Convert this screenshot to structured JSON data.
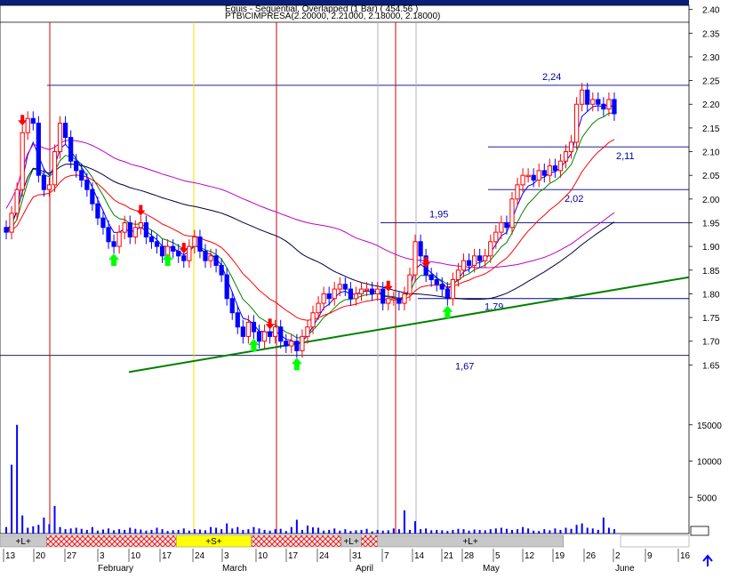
{
  "header": {
    "line1": "Equis - Sequential, Overlapped (1 Bar) ( 454.56 )",
    "line2": "PTB\\CIMPRESA(2.20000, 2.21000, 2.18000, 2.18000)"
  },
  "colors": {
    "up_candle": "#ff0000",
    "down_candle": "#0000ff",
    "volume": "#0000ff",
    "ema_fast": "#0000ff",
    "ema_mid": "#008000",
    "ema_slow": "#ff0000",
    "ma_magenta": "#c000c0",
    "ma_navy": "#000040",
    "trendline": "#008000",
    "buy_arrow": "#00ff00",
    "sell_arrow": "#ff0000"
  },
  "chart_data": {
    "type": "candlestick",
    "title": "PTB\\CIMPRESA(2.20000, 2.21000, 2.18000, 2.18000)",
    "ylim": [
      1.6,
      2.42
    ],
    "y_ticks": [
      1.65,
      1.7,
      1.75,
      1.8,
      1.85,
      1.9,
      1.95,
      2.0,
      2.05,
      2.1,
      2.15,
      2.2,
      2.25,
      2.3,
      2.35,
      2.4
    ],
    "y_tick_labels": [
      "1.65",
      "1.70",
      "1.75",
      "1.80",
      "1.85",
      "1.90",
      "1.95",
      "2.00",
      "2.05",
      "2.10",
      "2.15",
      "2.20",
      "2.25",
      "2.30",
      "2.35",
      "2.40"
    ],
    "volume_ticks": [
      5000,
      10000,
      15000
    ],
    "volume_tick_labels": [
      "5000",
      "10000",
      "15000"
    ],
    "volume_ylim": [
      0,
      20000
    ],
    "x_day_labels": [
      "13",
      "20",
      "27",
      "3",
      "10",
      "17",
      "24",
      "3",
      "10",
      "17",
      "24",
      "31",
      "7",
      "14",
      "21",
      "28",
      "5",
      "12",
      "19",
      "26",
      "2",
      "9",
      "16"
    ],
    "x_month_labels": [
      "February",
      "March",
      "April",
      "May",
      "June"
    ],
    "horizontal_levels": [
      {
        "value": 2.24,
        "label": "2,24"
      },
      {
        "value": 2.11,
        "label": "2,11"
      },
      {
        "value": 2.02,
        "label": "2,02"
      },
      {
        "value": 1.95,
        "label": "1,95"
      },
      {
        "value": 1.79,
        "label": "1,79"
      },
      {
        "value": 1.67,
        "label": "1,67"
      }
    ],
    "trendline": {
      "start": [
        0.18,
        1.635
      ],
      "end": [
        1.0,
        1.835
      ]
    },
    "signal_bands": [
      {
        "label": "+L+",
        "start": 0.0,
        "end": 0.075,
        "style": "gray"
      },
      {
        "label": "",
        "start": 0.075,
        "end": 0.284,
        "style": "hatch"
      },
      {
        "label": "+S+",
        "start": 0.284,
        "end": 0.405,
        "style": "yellow"
      },
      {
        "label": "",
        "start": 0.405,
        "end": 0.55,
        "style": "hatch"
      },
      {
        "label": "+L+",
        "start": 0.55,
        "end": 0.582,
        "style": "gray"
      },
      {
        "label": "",
        "start": 0.582,
        "end": 0.608,
        "style": "hatch"
      },
      {
        "label": "+L+",
        "start": 0.608,
        "end": 0.908,
        "style": "gray"
      }
    ],
    "candles_close": [
      1.93,
      1.97,
      2.02,
      2.14,
      2.17,
      2.16,
      2.05,
      2.02,
      2.03,
      2.1,
      2.16,
      2.13,
      2.08,
      2.06,
      2.04,
      2.02,
      1.99,
      1.96,
      1.94,
      1.91,
      1.9,
      1.93,
      1.95,
      1.92,
      1.94,
      1.95,
      1.92,
      1.91,
      1.9,
      1.88,
      1.9,
      1.89,
      1.88,
      1.87,
      1.9,
      1.92,
      1.89,
      1.87,
      1.88,
      1.86,
      1.84,
      1.79,
      1.76,
      1.73,
      1.71,
      1.74,
      1.72,
      1.7,
      1.72,
      1.71,
      1.73,
      1.7,
      1.69,
      1.7,
      1.68,
      1.71,
      1.73,
      1.76,
      1.78,
      1.8,
      1.79,
      1.81,
      1.82,
      1.81,
      1.79,
      1.8,
      1.81,
      1.81,
      1.8,
      1.81,
      1.78,
      1.79,
      1.79,
      1.78,
      1.8,
      1.84,
      1.91,
      1.88,
      1.84,
      1.83,
      1.82,
      1.81,
      1.79,
      1.83,
      1.85,
      1.87,
      1.86,
      1.88,
      1.87,
      1.88,
      1.91,
      1.93,
      1.95,
      1.94,
      2.0,
      2.03,
      2.05,
      2.05,
      2.04,
      2.06,
      2.05,
      2.07,
      2.06,
      2.08,
      2.1,
      2.12,
      2.2,
      2.23,
      2.2,
      2.21,
      2.2,
      2.19,
      2.21,
      2.18
    ],
    "volume_values": [
      900,
      9500,
      15000,
      2500,
      800,
      1000,
      1200,
      2200,
      1300,
      3800,
      900,
      600,
      700,
      800,
      650,
      500,
      900,
      400,
      550,
      700,
      450,
      600,
      500,
      800,
      650,
      550,
      400,
      500,
      800,
      600,
      350,
      450,
      500,
      700,
      400,
      600,
      550,
      450,
      900,
      800,
      600,
      1400,
      700,
      900,
      500,
      600,
      900,
      700,
      500,
      400,
      600,
      650,
      350,
      900,
      1900,
      500,
      1100,
      850,
      800,
      400,
      500,
      700,
      400,
      600,
      350,
      450,
      500,
      650,
      300,
      500,
      400,
      450,
      700,
      600,
      3200,
      500,
      1700,
      600,
      700,
      450,
      500,
      450,
      350,
      500,
      650,
      600,
      400,
      550,
      500,
      450,
      600,
      700,
      800,
      650,
      500,
      600,
      900,
      700,
      400,
      350,
      600,
      450,
      700,
      500,
      800,
      650,
      1200,
      1400,
      800,
      700,
      500,
      2200,
      800,
      600
    ]
  }
}
